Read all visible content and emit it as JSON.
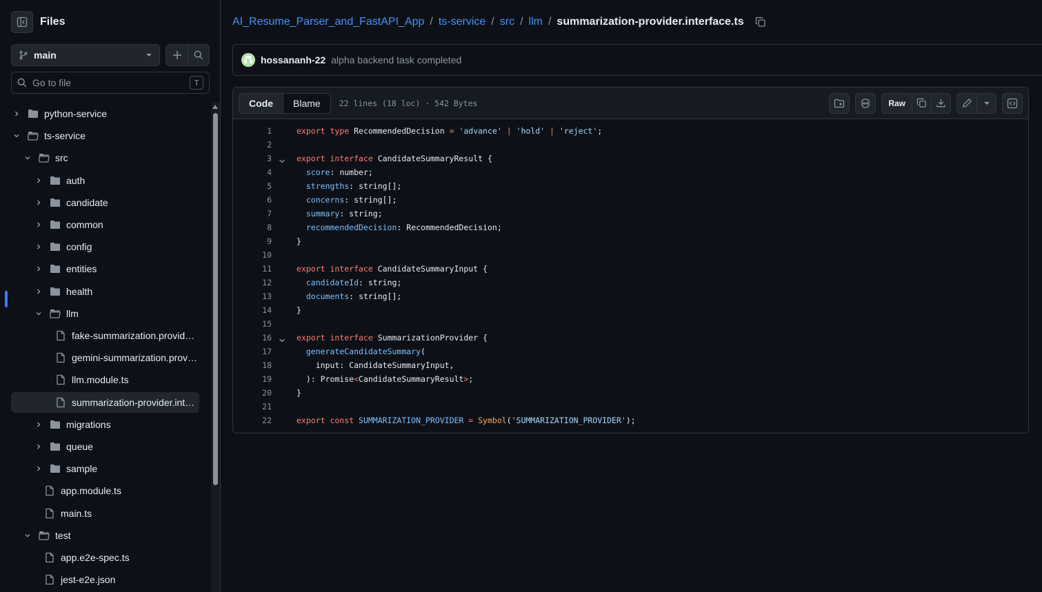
{
  "sidebar": {
    "title": "Files",
    "branch": "main",
    "goto_placeholder": "Go to file",
    "goto_shortcut": "T",
    "tree": [
      {
        "label": "python-service",
        "kind": "folder",
        "depth": 0,
        "open": false
      },
      {
        "label": "ts-service",
        "kind": "folder",
        "depth": 0,
        "open": true
      },
      {
        "label": "src",
        "kind": "folder",
        "depth": 1,
        "open": true
      },
      {
        "label": "auth",
        "kind": "folder",
        "depth": 2,
        "open": false
      },
      {
        "label": "candidate",
        "kind": "folder",
        "depth": 2,
        "open": false
      },
      {
        "label": "common",
        "kind": "folder",
        "depth": 2,
        "open": false
      },
      {
        "label": "config",
        "kind": "folder",
        "depth": 2,
        "open": false
      },
      {
        "label": "entities",
        "kind": "folder",
        "depth": 2,
        "open": false
      },
      {
        "label": "health",
        "kind": "folder",
        "depth": 2,
        "open": false
      },
      {
        "label": "llm",
        "kind": "folder",
        "depth": 2,
        "open": true
      },
      {
        "label": "fake-summarization.provider.ts",
        "kind": "file",
        "depth": 3
      },
      {
        "label": "gemini-summarization.provid...",
        "kind": "file",
        "depth": 3
      },
      {
        "label": "llm.module.ts",
        "kind": "file",
        "depth": 3
      },
      {
        "label": "summarization-provider.inter...",
        "kind": "file",
        "depth": 3,
        "selected": true
      },
      {
        "label": "migrations",
        "kind": "folder",
        "depth": 2,
        "open": false
      },
      {
        "label": "queue",
        "kind": "folder",
        "depth": 2,
        "open": false
      },
      {
        "label": "sample",
        "kind": "folder",
        "depth": 2,
        "open": false
      },
      {
        "label": "app.module.ts",
        "kind": "file",
        "depth": 2
      },
      {
        "label": "main.ts",
        "kind": "file",
        "depth": 2
      },
      {
        "label": "test",
        "kind": "folder",
        "depth": 1,
        "open": true
      },
      {
        "label": "app.e2e-spec.ts",
        "kind": "file",
        "depth": 2
      },
      {
        "label": "jest-e2e.json",
        "kind": "file",
        "depth": 2
      }
    ]
  },
  "breadcrumb": {
    "repo": "AI_Resume_Parser_and_FastAPI_App",
    "parts": [
      "ts-service",
      "src",
      "llm"
    ],
    "current": "summarization-provider.interface.ts",
    "separator": "/"
  },
  "commit": {
    "author": "hossananh-22",
    "message": "alpha backend task completed"
  },
  "file": {
    "tab_code": "Code",
    "tab_blame": "Blame",
    "meta": "22 lines (18 loc) · 542 Bytes",
    "raw_label": "Raw"
  },
  "code_lines": [
    [
      [
        "k",
        "export type "
      ],
      [
        "t",
        "RecommendedDecision "
      ],
      [
        "k",
        "= "
      ],
      [
        "s",
        "'advance' "
      ],
      [
        "k",
        "| "
      ],
      [
        "s",
        "'hold' "
      ],
      [
        "k",
        "| "
      ],
      [
        "s",
        "'reject'"
      ],
      [
        "t",
        ";"
      ]
    ],
    [],
    [
      [
        "k",
        "export interface "
      ],
      [
        "t",
        "CandidateSummaryResult {"
      ]
    ],
    [
      [
        "t",
        "  "
      ],
      [
        "p",
        "score"
      ],
      [
        "t",
        ": number;"
      ]
    ],
    [
      [
        "t",
        "  "
      ],
      [
        "p",
        "strengths"
      ],
      [
        "t",
        ": string[];"
      ]
    ],
    [
      [
        "t",
        "  "
      ],
      [
        "p",
        "concerns"
      ],
      [
        "t",
        ": string[];"
      ]
    ],
    [
      [
        "t",
        "  "
      ],
      [
        "p",
        "summary"
      ],
      [
        "t",
        ": string;"
      ]
    ],
    [
      [
        "t",
        "  "
      ],
      [
        "p",
        "recommendedDecision"
      ],
      [
        "t",
        ": RecommendedDecision;"
      ]
    ],
    [
      [
        "t",
        "}"
      ]
    ],
    [],
    [
      [
        "k",
        "export interface "
      ],
      [
        "t",
        "CandidateSummaryInput {"
      ]
    ],
    [
      [
        "t",
        "  "
      ],
      [
        "p",
        "candidateId"
      ],
      [
        "t",
        ": string;"
      ]
    ],
    [
      [
        "t",
        "  "
      ],
      [
        "p",
        "documents"
      ],
      [
        "t",
        ": string[];"
      ]
    ],
    [
      [
        "t",
        "}"
      ]
    ],
    [],
    [
      [
        "k",
        "export interface "
      ],
      [
        "t",
        "SummarizationProvider {"
      ]
    ],
    [
      [
        "t",
        "  "
      ],
      [
        "p",
        "generateCandidateSummary"
      ],
      [
        "t",
        "("
      ]
    ],
    [
      [
        "t",
        "    input: CandidateSummaryInput,"
      ]
    ],
    [
      [
        "t",
        "  ): Promise"
      ],
      [
        "k",
        "<"
      ],
      [
        "t",
        "CandidateSummaryResult"
      ],
      [
        "k",
        ">"
      ],
      [
        "t",
        ";"
      ]
    ],
    [
      [
        "t",
        "}"
      ]
    ],
    [],
    [
      [
        "k",
        "export const "
      ],
      [
        "p",
        "SUMMARIZATION_PROVIDER "
      ],
      [
        "k",
        "= "
      ],
      [
        "c",
        "Symbol"
      ],
      [
        "t",
        "("
      ],
      [
        "s",
        "'SUMMARIZATION_PROVIDER'"
      ],
      [
        "t",
        ");"
      ]
    ]
  ],
  "fold_lines": [
    3,
    16
  ]
}
